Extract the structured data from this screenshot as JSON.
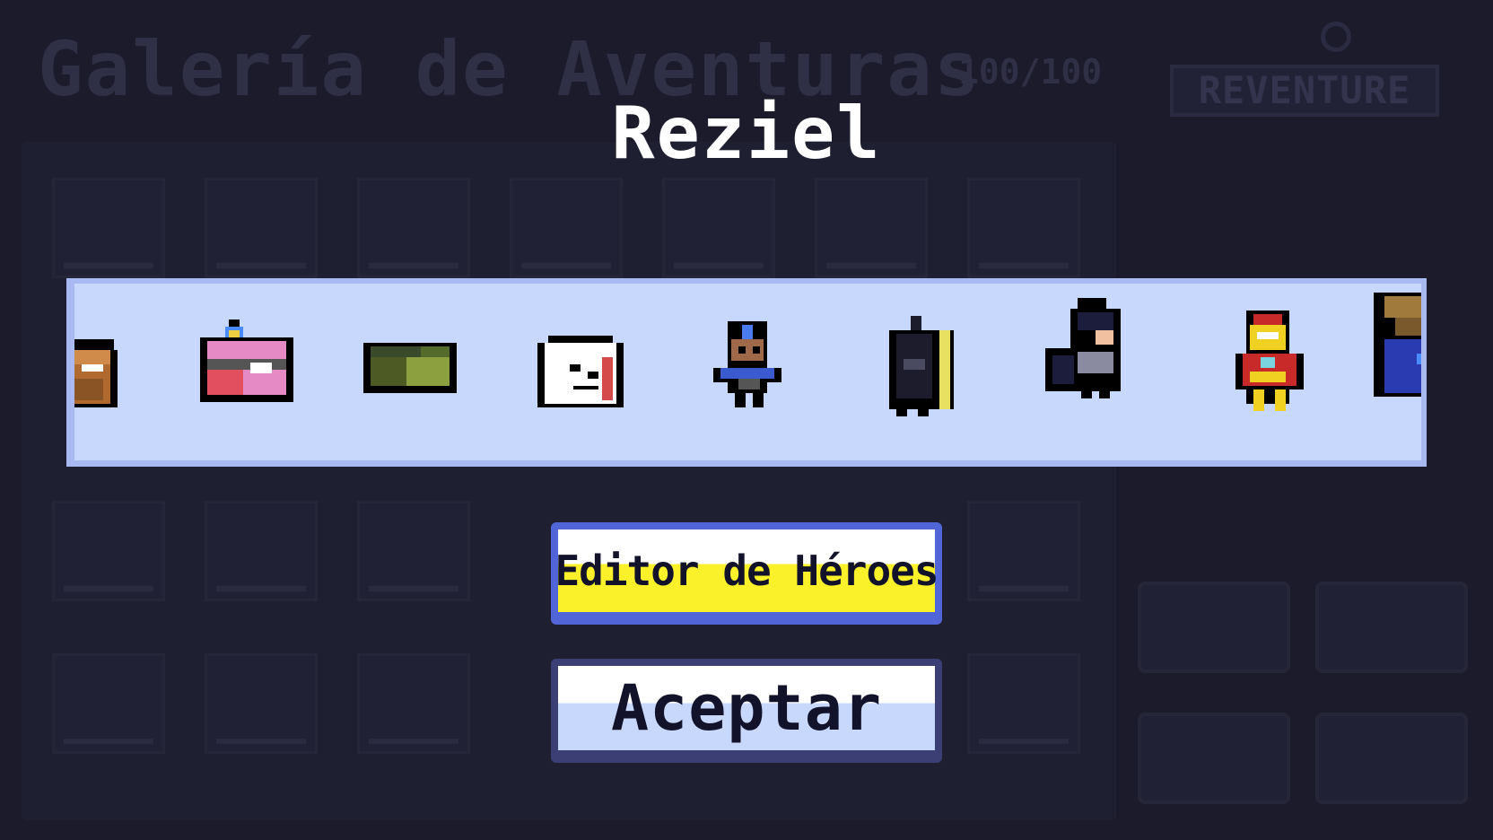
{
  "background": {
    "title": "Galería de Aventuras",
    "counter": "100/100",
    "logo": "REVENTURE"
  },
  "modal": {
    "hero_name": "Reziel",
    "heroes": [
      {
        "name": "bearded-hero-icon",
        "colors": [
          "#c47a3c",
          "#7a4a1c",
          "#ffffff"
        ]
      },
      {
        "name": "treasure-chest-hero-icon",
        "colors": [
          "#e24f5f",
          "#e58ac4",
          "#4a8cff"
        ]
      },
      {
        "name": "green-slime-hero-icon",
        "colors": [
          "#6e8a2e",
          "#4e5a24",
          "#2e3a2c"
        ]
      },
      {
        "name": "ghost-hero-icon",
        "colors": [
          "#ffffff",
          "#d44a4a",
          "#000000"
        ]
      },
      {
        "name": "blue-haired-hero-icon",
        "colors": [
          "#3a5bd0",
          "#a06a4a",
          "#2a2a40"
        ]
      },
      {
        "name": "bat-hero-icon",
        "colors": [
          "#1c1c2c",
          "#4a4a60",
          "#e8e060"
        ]
      },
      {
        "name": "dark-knight-hero-icon",
        "colors": [
          "#1c1c3c",
          "#8a8aa0",
          "#f0c0a0"
        ]
      },
      {
        "name": "iron-hero-icon",
        "colors": [
          "#c82a2a",
          "#f0d020",
          "#7ad4e0"
        ]
      },
      {
        "name": "wizard-hero-icon",
        "colors": [
          "#2a3ab0",
          "#a07a3c",
          "#000000"
        ]
      }
    ],
    "editor_button": "Editor de Héroes",
    "accept_button": "Aceptar"
  }
}
